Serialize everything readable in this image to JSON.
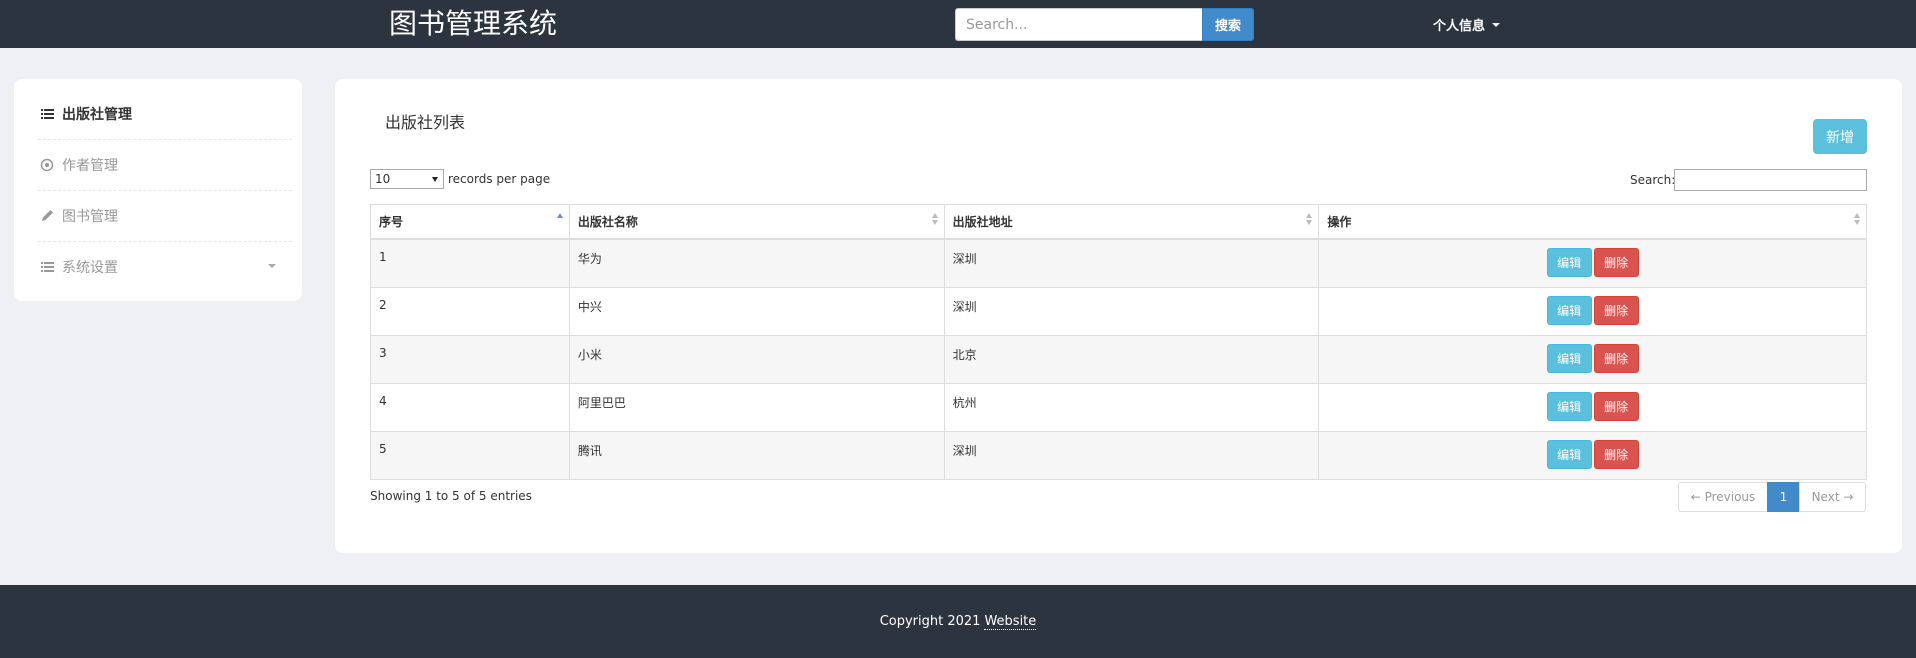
{
  "header": {
    "brand": "图书管理系统",
    "search_placeholder": "Search...",
    "search_button": "搜索",
    "user_menu": "个人信息"
  },
  "sidebar": {
    "items": [
      {
        "label": "出版社管理",
        "icon": "list-icon",
        "active": true
      },
      {
        "label": "作者管理",
        "icon": "target-icon",
        "active": false
      },
      {
        "label": "图书管理",
        "icon": "pencil-icon",
        "active": false
      },
      {
        "label": "系统设置",
        "icon": "list-icon",
        "active": false
      }
    ]
  },
  "main": {
    "title": "出版社列表",
    "add_button": "新增",
    "page_length": "10",
    "records_label": "records per page",
    "filter_label": "Search:",
    "columns": [
      "序号",
      "出版社名称",
      "出版社地址",
      "操作"
    ],
    "rows": [
      {
        "id": "1",
        "name": "华为",
        "address": "深圳"
      },
      {
        "id": "2",
        "name": "中兴",
        "address": "深圳"
      },
      {
        "id": "3",
        "name": "小米",
        "address": "北京"
      },
      {
        "id": "4",
        "name": "阿里巴巴",
        "address": "杭州"
      },
      {
        "id": "5",
        "name": "腾讯",
        "address": "深圳"
      }
    ],
    "edit_label": "编辑",
    "delete_label": "删除",
    "info": "Showing 1 to 5 of 5 entries",
    "pager": {
      "prev": "← Previous",
      "current": "1",
      "next": "Next →"
    }
  },
  "footer": {
    "copyright": "Copyright 2021",
    "link": "Website"
  },
  "colors": {
    "header_bg": "#2c3440",
    "primary": "#428bca",
    "info": "#5bc0de",
    "danger": "#d9534f"
  }
}
